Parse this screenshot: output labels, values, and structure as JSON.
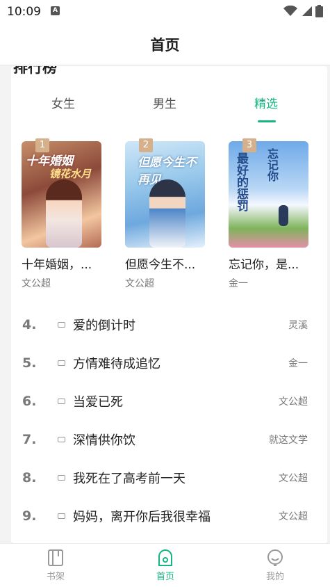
{
  "status": {
    "time": "10:09",
    "a_badge": "A"
  },
  "header": {
    "title": "首页"
  },
  "section": {
    "title_clipped": "排行榜"
  },
  "tabs": [
    {
      "label": "女生"
    },
    {
      "label": "男生"
    },
    {
      "label": "精选",
      "active": true
    }
  ],
  "top_books": [
    {
      "rank": "1",
      "title": "十年婚姻，...",
      "author": "文公超",
      "cover_text_a": "十年婚姻",
      "cover_text_b": "镜花水月"
    },
    {
      "rank": "2",
      "title": "但愿今生不...",
      "author": "文公超",
      "cover_text_a": "但愿今生不再见"
    },
    {
      "rank": "3",
      "title": "忘记你，是...",
      "author": "金一",
      "cover_text_a": "最好的惩罚",
      "cover_text_b": "忘记你"
    }
  ],
  "ranked_list": [
    {
      "rank": "4.",
      "title": "爱的倒计时",
      "author": "灵溪"
    },
    {
      "rank": "5.",
      "title": "方情难待成追忆",
      "author": "金一"
    },
    {
      "rank": "6.",
      "title": "当爱已死",
      "author": "文公超"
    },
    {
      "rank": "7.",
      "title": "深情供你饮",
      "author": "就这文学"
    },
    {
      "rank": "8.",
      "title": "我死在了高考前一天",
      "author": "文公超"
    },
    {
      "rank": "9.",
      "title": "妈妈，离开你后我很幸福",
      "author": "文公超"
    }
  ],
  "bottom_nav": [
    {
      "label": "书架",
      "icon": "bookshelf-icon"
    },
    {
      "label": "首页",
      "icon": "home-icon",
      "active": true
    },
    {
      "label": "我的",
      "icon": "profile-icon"
    }
  ],
  "colors": {
    "accent": "#16b77f",
    "badge": "#d5b08a"
  }
}
